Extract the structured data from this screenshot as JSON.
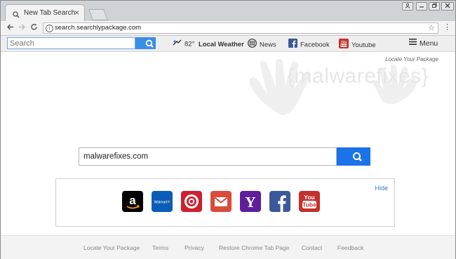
{
  "browser": {
    "tab_title": "New Tab Search",
    "tab_close": "×",
    "url": "search.searchlypackage.com"
  },
  "toolbar": {
    "search_placeholder": "Search",
    "weather_temp": "82°",
    "weather_label": "Local Weather",
    "news_label": "News",
    "facebook_label": "Facebook",
    "youtube_label": "Youtube",
    "menu_label": "Menu"
  },
  "main": {
    "locate_link": "Locate Your Package",
    "watermark": "{malwarefixes}",
    "search_value": "malwarefixes.com",
    "hide_label": "Hide"
  },
  "shortcuts": [
    {
      "name": "amazon",
      "color": "#000000"
    },
    {
      "name": "walmart",
      "color": "#0a5cb8",
      "text": "Walmart"
    },
    {
      "name": "target",
      "color": "#cc1f2f"
    },
    {
      "name": "gmail",
      "color": "#d94b3b"
    },
    {
      "name": "yahoo",
      "color": "#5f1f9b",
      "text": "Y"
    },
    {
      "name": "facebook",
      "color": "#3b5998",
      "text": "f"
    },
    {
      "name": "youtube",
      "color": "#c4302b"
    }
  ],
  "footer": {
    "links": [
      "Locate Your Package",
      "Terms",
      "Privacy",
      "Restore Chrome Tab Page",
      "Contact",
      "Feedback"
    ]
  },
  "colors": {
    "accent_blue": "#1a73e8",
    "toolbar_search_blue": "#3b8ee8"
  }
}
